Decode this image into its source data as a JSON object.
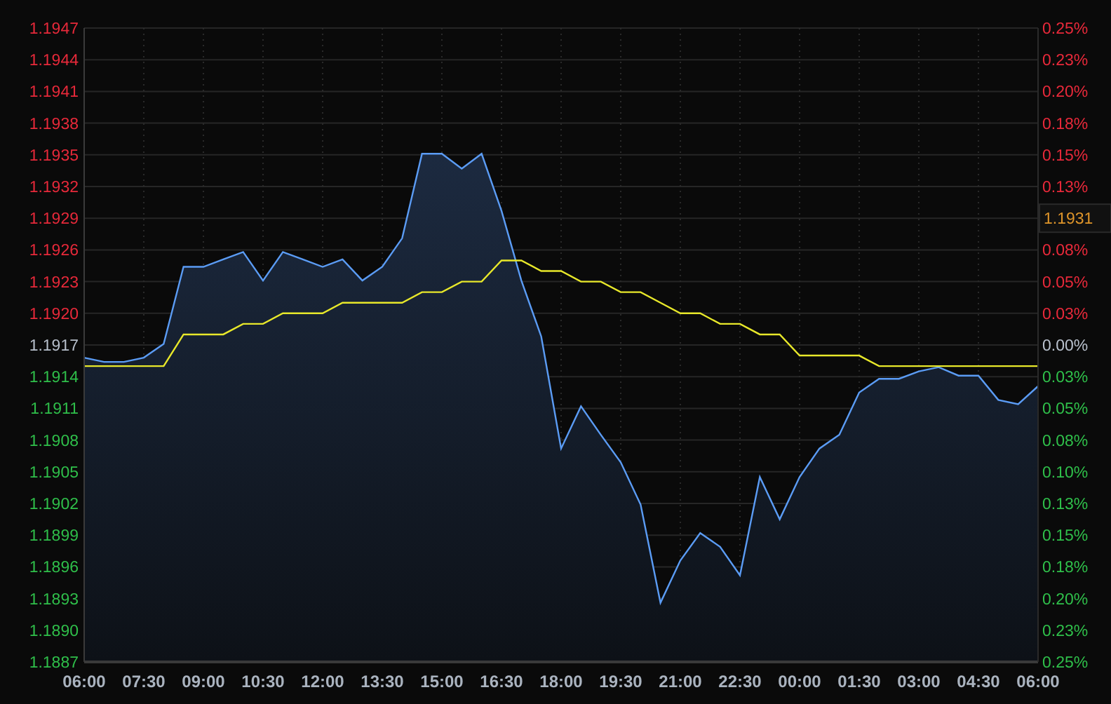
{
  "chart": {
    "chart_data": {
      "type": "area",
      "grid": true,
      "categories": [
        "06:00",
        null,
        null,
        "07:30",
        null,
        null,
        "09:00",
        null,
        null,
        "10:30",
        null,
        null,
        "12:00",
        null,
        null,
        "13:30",
        null,
        null,
        "15:00",
        null,
        null,
        "16:30",
        null,
        null,
        "18:00",
        null,
        null,
        "19:30",
        null,
        null,
        "21:00",
        null,
        null,
        "22:30",
        null,
        null,
        "00:00",
        null,
        null,
        "01:30",
        null,
        null,
        "03:00",
        null,
        null,
        "04:30",
        null,
        null,
        "06:00"
      ],
      "series": [
        {
          "type": "area",
          "color": "#5b9cf5",
          "values": [
            1.19158,
            1.19154,
            1.19154,
            1.19158,
            1.19171,
            1.19244,
            1.19244,
            1.19251,
            1.19258,
            1.19231,
            1.19258,
            1.19251,
            1.19244,
            1.19251,
            1.19231,
            1.19244,
            1.19271,
            1.19351,
            1.19351,
            1.19337,
            1.19351,
            1.19297,
            1.19231,
            1.19178,
            1.19072,
            1.19112,
            1.19085,
            1.19059,
            1.19019,
            1.18926,
            1.18966,
            1.18992,
            1.18979,
            1.18952,
            1.19045,
            1.19005,
            1.19045,
            1.19072,
            1.19085,
            1.19125,
            1.19138,
            1.19138,
            1.19145,
            1.19149,
            1.19141,
            1.19141,
            1.19118,
            1.19114,
            1.19131
          ]
        },
        {
          "type": "line",
          "color": "#e8e82a",
          "values": [
            1.1915,
            1.1915,
            1.1915,
            1.1915,
            1.1915,
            1.1918,
            1.1918,
            1.1918,
            1.1919,
            1.1919,
            1.192,
            1.192,
            1.192,
            1.1921,
            1.1921,
            1.1921,
            1.1921,
            1.1922,
            1.1922,
            1.1923,
            1.1923,
            1.1925,
            1.1925,
            1.1924,
            1.1924,
            1.1923,
            1.1923,
            1.1922,
            1.1922,
            1.1921,
            1.192,
            1.192,
            1.1919,
            1.1919,
            1.1918,
            1.1918,
            1.1916,
            1.1916,
            1.1916,
            1.1916,
            1.1915,
            1.1915,
            1.1915,
            1.1915,
            1.1915,
            1.1915,
            1.1915,
            1.1915,
            1.1915
          ]
        }
      ],
      "ylim": [
        1.1887,
        1.1947
      ],
      "yticks": [
        {
          "value": 1.1947,
          "label": "1.1947"
        },
        {
          "value": 1.1944,
          "label": "1.1944"
        },
        {
          "value": 1.1941,
          "label": "1.1941"
        },
        {
          "value": 1.1938,
          "label": "1.1938"
        },
        {
          "value": 1.1935,
          "label": "1.1935"
        },
        {
          "value": 1.1932,
          "label": "1.1932"
        },
        {
          "value": 1.1929,
          "label": "1.1929"
        },
        {
          "value": 1.1926,
          "label": "1.1926"
        },
        {
          "value": 1.1923,
          "label": "1.1923"
        },
        {
          "value": 1.192,
          "label": "1.1920"
        },
        {
          "value": 1.1917,
          "label": "1.1917"
        },
        {
          "value": 1.1914,
          "label": "1.1914"
        },
        {
          "value": 1.1911,
          "label": "1.1911"
        },
        {
          "value": 1.1908,
          "label": "1.1908"
        },
        {
          "value": 1.1905,
          "label": "1.1905"
        },
        {
          "value": 1.1902,
          "label": "1.1902"
        },
        {
          "value": 1.1899,
          "label": "1.1899"
        },
        {
          "value": 1.1896,
          "label": "1.1896"
        },
        {
          "value": 1.1893,
          "label": "1.1893"
        },
        {
          "value": 1.189,
          "label": "1.1890"
        },
        {
          "value": 1.1887,
          "label": "1.1887"
        }
      ]
    }
  },
  "right_axis": [
    {
      "kind": "percent",
      "text": "0.25%",
      "color": "#e8293a"
    },
    {
      "kind": "percent",
      "text": "0.23%",
      "color": "#e8293a"
    },
    {
      "kind": "percent",
      "text": "0.20%",
      "color": "#e8293a"
    },
    {
      "kind": "percent",
      "text": "0.18%",
      "color": "#e8293a"
    },
    {
      "kind": "percent",
      "text": "0.15%",
      "color": "#e8293a"
    },
    {
      "kind": "percent",
      "text": "0.13%",
      "color": "#e8293a"
    },
    {
      "kind": "price",
      "text": "1.1931",
      "color": "#e0962a"
    },
    {
      "kind": "percent",
      "text": "0.08%",
      "color": "#e8293a"
    },
    {
      "kind": "percent",
      "text": "0.05%",
      "color": "#e8293a"
    },
    {
      "kind": "percent",
      "text": "0.03%",
      "color": "#e8293a"
    },
    {
      "kind": "percent",
      "text": "0.00%",
      "color": "#b8c0cc"
    },
    {
      "kind": "percent",
      "text": "0.03%",
      "color": "#2fbf4a"
    },
    {
      "kind": "percent",
      "text": "0.05%",
      "color": "#2fbf4a"
    },
    {
      "kind": "percent",
      "text": "0.08%",
      "color": "#2fbf4a"
    },
    {
      "kind": "percent",
      "text": "0.10%",
      "color": "#2fbf4a"
    },
    {
      "kind": "percent",
      "text": "0.13%",
      "color": "#2fbf4a"
    },
    {
      "kind": "percent",
      "text": "0.15%",
      "color": "#2fbf4a"
    },
    {
      "kind": "percent",
      "text": "0.18%",
      "color": "#2fbf4a"
    },
    {
      "kind": "percent",
      "text": "0.20%",
      "color": "#2fbf4a"
    },
    {
      "kind": "percent",
      "text": "0.23%",
      "color": "#2fbf4a"
    },
    {
      "kind": "percent",
      "text": "0.25%",
      "color": "#2fbf4a"
    }
  ]
}
